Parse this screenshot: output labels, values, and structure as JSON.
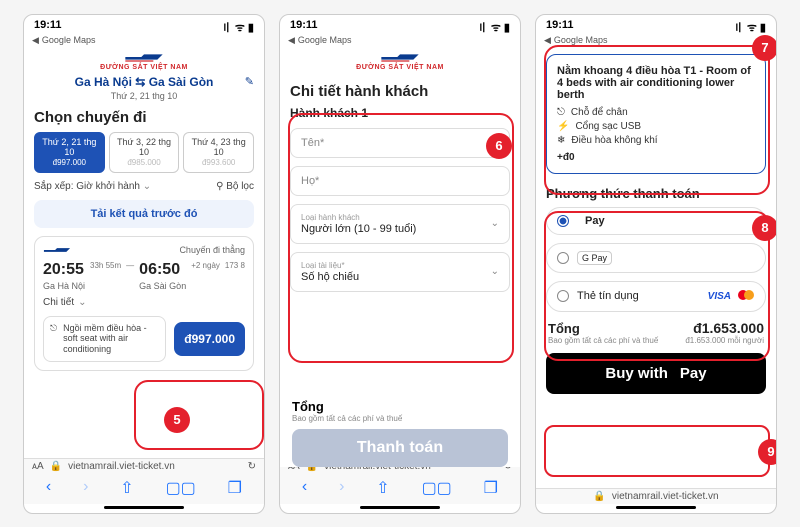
{
  "status": {
    "time": "19:11",
    "breadcrumb": "Google Maps"
  },
  "logo": {
    "brand": "VNR",
    "tagline": "ĐƯỜNG SẮT VIỆT NAM"
  },
  "s1": {
    "route_from": "Ga Hà Nội",
    "route_to": "Ga Sài Gòn",
    "route_date": "Thứ 2, 21 thg 10",
    "heading": "Chọn chuyến đi",
    "tabs": [
      {
        "label": "Thứ 2, 21 thg\n10",
        "price": "đ997.000"
      },
      {
        "label": "Thứ 3, 22 thg\n10",
        "price": "đ985.000"
      },
      {
        "label": "Thứ 4, 23 thg\n10",
        "price": "đ993.600"
      }
    ],
    "sort_label": "Sắp xếp:",
    "sort_value": "Giờ khởi hành",
    "filter": "Bộ lọc",
    "reload": "Tải kết quả trước đó",
    "card": {
      "direction": "Chuyến đi thẳng",
      "dep_time": "20:55",
      "arr_time": "06:50",
      "dur1": "33h\n55m",
      "dur2": "+2\nngày",
      "cars": "173\n8",
      "dep_station": "Ga Hà Nội",
      "arr_station": "Ga Sài Gòn",
      "detail": "Chi tiết",
      "seat": "Ngồi mềm điều hòa - soft seat with air conditioning",
      "price": "đ997.000"
    },
    "url": "vietnamrail.viet-ticket.vn"
  },
  "s2": {
    "heading": "Chi tiết hành khách",
    "pax_label": "Hành khách 1",
    "fields": {
      "first": "Tên*",
      "last": "Họ*",
      "type_label": "Loại hành khách",
      "type_value": "Người lớn (10 - 99 tuổi)",
      "doc_label": "Loại tài liệu*",
      "doc_value": "Số hộ chiếu"
    },
    "total_label": "Tổng",
    "total_sub": "Bao gồm tất cả các phí và thuế",
    "pay_btn": "Thanh toán",
    "url": "vietnamrail.viet-ticket.vn"
  },
  "s3": {
    "berth": {
      "title": "Nằm khoang 4 điều hòa T1 - Room of 4 beds with air conditioning lower berth",
      "feat1": "Chỗ để chân",
      "feat2": "Cổng sạc USB",
      "feat3": "Điều hòa không khí",
      "delta": "+đ0"
    },
    "pay_heading": "Phương thức thanh toán",
    "pay_opts": {
      "apple": "Pay",
      "google": "G Pay",
      "card": "Thẻ tín dụng"
    },
    "total_label": "Tổng",
    "total_sub": "Bao gồm tất cả các phí và thuế",
    "amount": "đ1.653.000",
    "per": "đ1.653.000 mỗi người",
    "buy_btn": "Buy with ",
    "buy_btn2": "Pay",
    "url": "vietnamrail.viet-ticket.vn"
  },
  "badges": {
    "b5": "5",
    "b6": "6",
    "b7": "7",
    "b8": "8",
    "b9": "9"
  }
}
